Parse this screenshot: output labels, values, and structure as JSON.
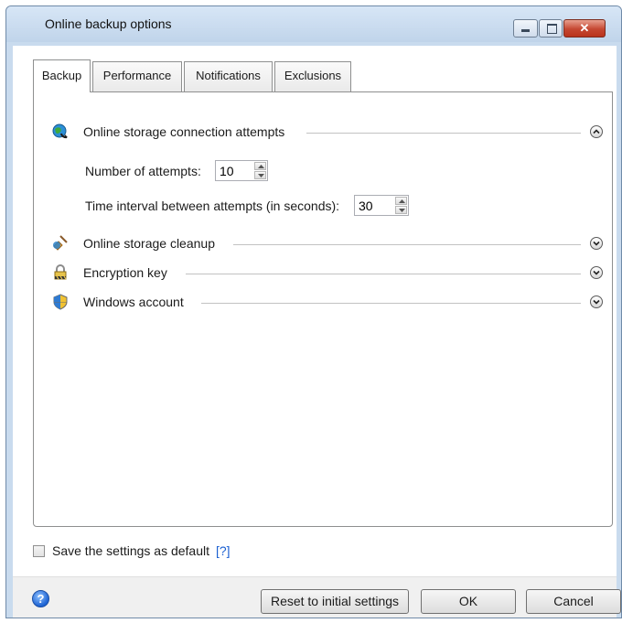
{
  "window": {
    "title": "Online backup options",
    "minimize_label": "minimize",
    "maximize_label": "maximize",
    "close_label": "✕"
  },
  "tabs": [
    {
      "label": "Backup",
      "active": true
    },
    {
      "label": "Performance",
      "active": false
    },
    {
      "label": "Notifications",
      "active": false
    },
    {
      "label": "Exclusions",
      "active": false
    }
  ],
  "sections": [
    {
      "label": "Online storage connection attempts",
      "icon": "globe-refresh-icon",
      "expanded": true
    },
    {
      "label": "Online storage cleanup",
      "icon": "broom-icon",
      "expanded": false
    },
    {
      "label": "Encryption key",
      "icon": "padlock-icon",
      "expanded": false
    },
    {
      "label": "Windows account",
      "icon": "shield-icon",
      "expanded": false
    }
  ],
  "connection": {
    "attempts_label": "Number of attempts:",
    "attempts_value": "10",
    "interval_label": "Time interval between attempts (in seconds):",
    "interval_value": "30"
  },
  "default_option": {
    "label": "Save the settings as default",
    "help_link": "[?]",
    "checked": false
  },
  "footer": {
    "help_icon": "question-icon",
    "reset_label": "Reset to initial settings",
    "ok_label": "OK",
    "cancel_label": "Cancel"
  },
  "colors": {
    "titlebar": "#c9dbee",
    "link": "#1a5fd1",
    "close_button": "#c54731"
  }
}
